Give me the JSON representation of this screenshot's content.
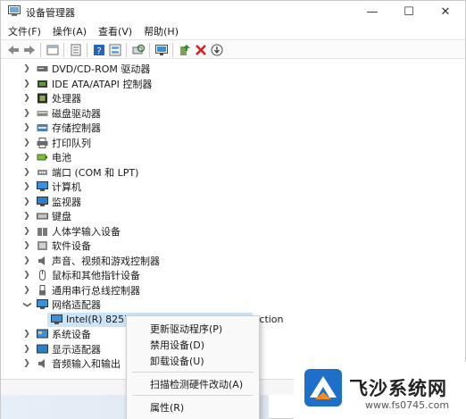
{
  "window": {
    "title": "设备管理器",
    "controls": {
      "minimize": "—",
      "maximize": "☐",
      "close": "✕"
    }
  },
  "menubar": [
    "文件(F)",
    "操作(A)",
    "查看(V)",
    "帮助(H)"
  ],
  "toolbar": {
    "icons": [
      "back-arrow-icon",
      "forward-arrow-icon",
      "view-icon",
      "properties-icon",
      "help-icon",
      "scan-hardware-icon",
      "monitor-icon",
      "update-driver-icon",
      "uninstall-icon",
      "disable-icon"
    ]
  },
  "tree": {
    "categories": [
      {
        "label": "DVD/CD-ROM 驱动器",
        "icon": "dvd-drive-icon",
        "expanded": false
      },
      {
        "label": "IDE ATA/ATAPI 控制器",
        "icon": "ide-controller-icon",
        "expanded": false
      },
      {
        "label": "处理器",
        "icon": "processor-icon",
        "expanded": false
      },
      {
        "label": "磁盘驱动器",
        "icon": "disk-drive-icon",
        "expanded": false
      },
      {
        "label": "存储控制器",
        "icon": "storage-controller-icon",
        "expanded": false
      },
      {
        "label": "打印队列",
        "icon": "printer-icon",
        "expanded": false
      },
      {
        "label": "电池",
        "icon": "battery-icon",
        "expanded": false
      },
      {
        "label": "端口 (COM 和 LPT)",
        "icon": "port-icon",
        "expanded": false
      },
      {
        "label": "计算机",
        "icon": "computer-icon",
        "expanded": false
      },
      {
        "label": "监视器",
        "icon": "monitor-icon",
        "expanded": false
      },
      {
        "label": "键盘",
        "icon": "keyboard-icon",
        "expanded": false
      },
      {
        "label": "人体学输入设备",
        "icon": "hid-icon",
        "expanded": false
      },
      {
        "label": "软件设备",
        "icon": "software-device-icon",
        "expanded": false
      },
      {
        "label": "声音、视频和游戏控制器",
        "icon": "sound-icon",
        "expanded": false
      },
      {
        "label": "鼠标和其他指针设备",
        "icon": "mouse-icon",
        "expanded": false
      },
      {
        "label": "通用串行总线控制器",
        "icon": "usb-icon",
        "expanded": false
      },
      {
        "label": "网络适配器",
        "icon": "network-adapter-icon",
        "expanded": true
      },
      {
        "label": "Intel(R) 82574L Gigabit Network Connection",
        "icon": "network-card-icon",
        "child": true,
        "selected": true
      },
      {
        "label": "系统设备",
        "icon": "system-device-icon",
        "expanded": false
      },
      {
        "label": "显示适配器",
        "icon": "display-adapter-icon",
        "expanded": false
      },
      {
        "label": "音频输入和输出",
        "icon": "audio-io-icon",
        "expanded": false
      }
    ]
  },
  "context_menu": {
    "items": [
      {
        "label": "更新驱动程序(P)"
      },
      {
        "label": "禁用设备(D)"
      },
      {
        "label": "卸载设备(U)"
      },
      {
        "separator": true
      },
      {
        "label": "扫描检测硬件改动(A)"
      },
      {
        "separator": true
      },
      {
        "label": "属性(R)"
      }
    ]
  },
  "watermark": {
    "name": "飞沙系统网",
    "url": "www.fs0745.com"
  },
  "colors": {
    "selection": "#cce4f7",
    "accent_blue": "#1e6fc8",
    "delete_red": "#d32020",
    "watermark_orange": "#f28c1b"
  }
}
